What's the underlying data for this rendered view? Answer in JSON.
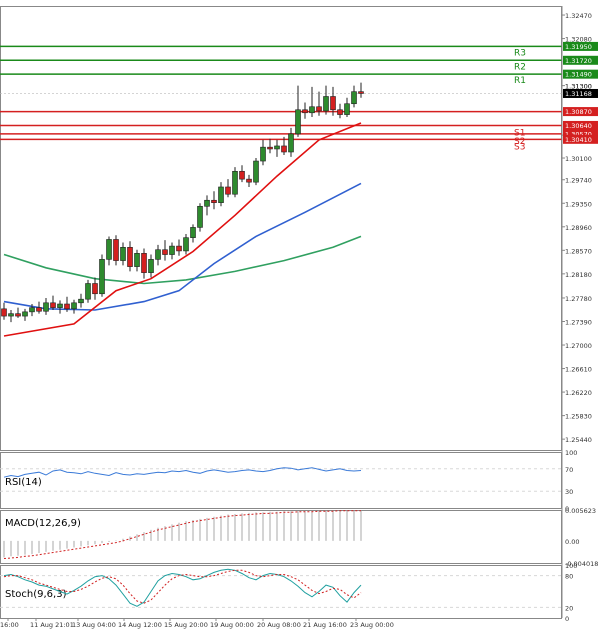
{
  "colors": {
    "bull": "#2e8b2e",
    "bear": "#d42020",
    "resistance": "#1a8a1a",
    "support": "#d42020",
    "ma_fast": "#e01010",
    "ma_mid": "#3060d0",
    "ma_slow": "#30a060",
    "rsi": "#3a7ad8",
    "macd_hist": "#aaaaaa",
    "macd_signal": "#d02020",
    "stoch_main": "#20a0a0",
    "stoch_signal": "#d02020",
    "grid": "#d8d8d8"
  },
  "chart_data": [
    {
      "type": "candlestick",
      "panel": "main",
      "ylim": [
        1.2526,
        1.3262
      ],
      "y_ticks": [
        "1.32470",
        "1.32080",
        "1.31300",
        "1.30480",
        "1.30100",
        "1.29740",
        "1.29350",
        "1.28960",
        "1.28570",
        "1.28180",
        "1.27780",
        "1.27390",
        "1.27000",
        "1.26610",
        "1.26220",
        "1.25830",
        "1.25440"
      ],
      "x_ticks": [
        "16:00",
        "11 Aug 21:01",
        "13 Aug 04:00",
        "14 Aug 12:00",
        "15 Aug 20:00",
        "19 Aug 00:00",
        "20 Aug 08:00",
        "21 Aug 16:00",
        "23 Aug 00:00"
      ],
      "candles": [
        [
          1.276,
          1.277,
          1.2742,
          1.2748
        ],
        [
          1.2748,
          1.2758,
          1.2738,
          1.2752
        ],
        [
          1.2752,
          1.2762,
          1.2745,
          1.2748
        ],
        [
          1.2748,
          1.276,
          1.274,
          1.2755
        ],
        [
          1.2755,
          1.2768,
          1.2748,
          1.2762
        ],
        [
          1.2762,
          1.2772,
          1.2752,
          1.2756
        ],
        [
          1.2756,
          1.2778,
          1.275,
          1.277
        ],
        [
          1.277,
          1.2782,
          1.2758,
          1.2762
        ],
        [
          1.2762,
          1.2774,
          1.2752,
          1.2768
        ],
        [
          1.2768,
          1.278,
          1.2755,
          1.276
        ],
        [
          1.276,
          1.2775,
          1.2752,
          1.277
        ],
        [
          1.277,
          1.2785,
          1.2762,
          1.2776
        ],
        [
          1.2776,
          1.2808,
          1.277,
          1.2802
        ],
        [
          1.2802,
          1.2812,
          1.2775,
          1.2785
        ],
        [
          1.2785,
          1.285,
          1.278,
          1.2842
        ],
        [
          1.2842,
          1.288,
          1.2832,
          1.2875
        ],
        [
          1.2875,
          1.2882,
          1.2832,
          1.284
        ],
        [
          1.284,
          1.287,
          1.2832,
          1.2862
        ],
        [
          1.2862,
          1.2872,
          1.2822,
          1.283
        ],
        [
          1.283,
          1.2858,
          1.2822,
          1.2852
        ],
        [
          1.2852,
          1.286,
          1.281,
          1.282
        ],
        [
          1.282,
          1.285,
          1.2812,
          1.2842
        ],
        [
          1.2842,
          1.2866,
          1.2832,
          1.2858
        ],
        [
          1.2858,
          1.2874,
          1.284,
          1.285
        ],
        [
          1.285,
          1.287,
          1.2842,
          1.2864
        ],
        [
          1.2864,
          1.2875,
          1.2848,
          1.2856
        ],
        [
          1.2856,
          1.2884,
          1.285,
          1.2878
        ],
        [
          1.2878,
          1.29,
          1.287,
          1.2895
        ],
        [
          1.2895,
          1.2935,
          1.2888,
          1.293
        ],
        [
          1.293,
          1.2948,
          1.2915,
          1.294
        ],
        [
          1.294,
          1.2955,
          1.2925,
          1.2936
        ],
        [
          1.2936,
          1.297,
          1.293,
          1.2962
        ],
        [
          1.2962,
          1.2975,
          1.2945,
          1.295
        ],
        [
          1.295,
          1.2995,
          1.2945,
          1.2988
        ],
        [
          1.2988,
          1.2998,
          1.297,
          1.2975
        ],
        [
          1.2975,
          1.2982,
          1.2962,
          1.297
        ],
        [
          1.297,
          1.301,
          1.2965,
          1.3005
        ],
        [
          1.3005,
          1.304,
          1.2998,
          1.3028
        ],
        [
          1.3028,
          1.3042,
          1.3018,
          1.3025
        ],
        [
          1.3025,
          1.304,
          1.3012,
          1.303
        ],
        [
          1.303,
          1.3045,
          1.3015,
          1.302
        ],
        [
          1.302,
          1.306,
          1.3012,
          1.305
        ],
        [
          1.305,
          1.313,
          1.3045,
          1.309
        ],
        [
          1.309,
          1.3102,
          1.3075,
          1.3085
        ],
        [
          1.3085,
          1.3128,
          1.3078,
          1.3095
        ],
        [
          1.3095,
          1.312,
          1.308,
          1.3088
        ],
        [
          1.3088,
          1.313,
          1.3082,
          1.3112
        ],
        [
          1.3112,
          1.3128,
          1.308,
          1.309
        ],
        [
          1.309,
          1.31,
          1.3076,
          1.3082
        ],
        [
          1.3082,
          1.311,
          1.3078,
          1.31
        ],
        [
          1.31,
          1.313,
          1.3094,
          1.312
        ],
        [
          1.312,
          1.3135,
          1.311,
          1.3117
        ]
      ],
      "ma_fast_path": [
        [
          0,
          1.2715
        ],
        [
          10,
          1.2735
        ],
        [
          16,
          1.279
        ],
        [
          21,
          1.281
        ],
        [
          27,
          1.2855
        ],
        [
          33,
          1.2915
        ],
        [
          39,
          1.298
        ],
        [
          45,
          1.304
        ],
        [
          51,
          1.3068
        ]
      ],
      "ma_mid_path": [
        [
          0,
          1.2772
        ],
        [
          6,
          1.276
        ],
        [
          13,
          1.2758
        ],
        [
          20,
          1.2772
        ],
        [
          25,
          1.279
        ],
        [
          30,
          1.2835
        ],
        [
          36,
          1.288
        ],
        [
          43,
          1.292
        ],
        [
          51,
          1.2968
        ]
      ],
      "ma_slow_path": [
        [
          0,
          1.285
        ],
        [
          6,
          1.2828
        ],
        [
          13,
          1.281
        ],
        [
          20,
          1.2802
        ],
        [
          26,
          1.2808
        ],
        [
          33,
          1.2822
        ],
        [
          40,
          1.284
        ],
        [
          47,
          1.2862
        ],
        [
          51,
          1.288
        ]
      ],
      "levels": [
        {
          "label": "R3",
          "value_text": "1.31950",
          "value": 1.3195,
          "kind": "resistance"
        },
        {
          "label": "R2",
          "value_text": "1.31720",
          "value": 1.3172,
          "kind": "resistance"
        },
        {
          "label": "R1",
          "value_text": "1.31490",
          "value": 1.3149,
          "kind": "resistance"
        },
        {
          "label": "",
          "value_text": "1.30870",
          "value": 1.3087,
          "kind": "support"
        },
        {
          "label": "S1",
          "value_text": "1.30640",
          "value": 1.3064,
          "kind": "support"
        },
        {
          "label": "S2",
          "value_text": "1.30570",
          "value": 1.305,
          "kind": "support"
        },
        {
          "label": "S3",
          "value_text": "1.30410",
          "value": 1.3041,
          "kind": "support"
        }
      ],
      "current_price_text": "1.31168",
      "current_price": 1.3117,
      "extra_tick_text": "1.31300"
    },
    {
      "type": "line",
      "panel": "rsi",
      "title": "RSI(14)",
      "ylim": [
        0,
        100
      ],
      "y_ticks": [
        "100",
        "70",
        "30",
        "0"
      ],
      "values": [
        55,
        58,
        56,
        60,
        62,
        64,
        59,
        66,
        68,
        64,
        63,
        61,
        65,
        62,
        60,
        58,
        63,
        60,
        59,
        61,
        60,
        62,
        64,
        63,
        66,
        65,
        67,
        64,
        62,
        66,
        68,
        66,
        64,
        65,
        67,
        68,
        66,
        65,
        67,
        70,
        72,
        71,
        68,
        70,
        72,
        69,
        66,
        68,
        70,
        67,
        66,
        67
      ]
    },
    {
      "type": "bar+line",
      "panel": "macd",
      "title": "MACD(12,26,9)",
      "ylim": [
        -0.004018,
        0.005623
      ],
      "y_ticks": [
        "0.005623",
        "0.00",
        "-0.004018"
      ],
      "hist": [
        -0.003,
        -0.0028,
        -0.0027,
        -0.0025,
        -0.0024,
        -0.0022,
        -0.002,
        -0.0018,
        -0.0016,
        -0.0014,
        -0.0012,
        -0.001,
        -0.0008,
        -0.0006,
        -0.0004,
        -0.0002,
        0.0001,
        0.0004,
        0.0008,
        0.0012,
        0.0016,
        0.002,
        0.0024,
        0.0027,
        0.003,
        0.0033,
        0.0036,
        0.0038,
        0.004,
        0.0042,
        0.0044,
        0.0046,
        0.0048,
        0.0049,
        0.005,
        0.0051,
        0.0052,
        0.0052,
        0.0053,
        0.0053,
        0.0054,
        0.0054,
        0.0054,
        0.0054,
        0.0054,
        0.0055,
        0.0055,
        0.0055,
        0.0055,
        0.0055,
        0.0055,
        0.0055
      ],
      "signal": [
        -0.0032,
        -0.0031,
        -0.003,
        -0.0028,
        -0.0027,
        -0.0025,
        -0.0023,
        -0.0021,
        -0.0019,
        -0.0017,
        -0.0015,
        -0.0013,
        -0.0011,
        -0.0009,
        -0.0007,
        -0.0005,
        -0.0003,
        0.0,
        0.0004,
        0.0008,
        0.0012,
        0.0016,
        0.002,
        0.0023,
        0.0026,
        0.0029,
        0.0032,
        0.0035,
        0.0037,
        0.0039,
        0.0041,
        0.0043,
        0.0045,
        0.0046,
        0.0047,
        0.0048,
        0.0049,
        0.005,
        0.005,
        0.0051,
        0.0052,
        0.0052,
        0.0053,
        0.0053,
        0.0053,
        0.0054,
        0.0054,
        0.0054,
        0.0055,
        0.0055,
        0.0055,
        0.0055
      ]
    },
    {
      "type": "line",
      "panel": "stoch",
      "title": "Stoch(9,6,3)",
      "ylim": [
        0,
        100
      ],
      "y_ticks": [
        "100",
        "80",
        "20",
        "0"
      ],
      "main": [
        80,
        82,
        78,
        72,
        68,
        62,
        60,
        55,
        50,
        45,
        52,
        60,
        70,
        78,
        80,
        74,
        62,
        45,
        28,
        22,
        30,
        50,
        70,
        80,
        84,
        82,
        78,
        72,
        74,
        80,
        86,
        90,
        92,
        90,
        84,
        76,
        72,
        80,
        84,
        82,
        78,
        70,
        60,
        48,
        40,
        50,
        62,
        58,
        42,
        30,
        48,
        62
      ],
      "signal": [
        78,
        80,
        80,
        76,
        72,
        66,
        62,
        58,
        54,
        50,
        50,
        54,
        60,
        68,
        75,
        78,
        74,
        62,
        46,
        32,
        28,
        34,
        48,
        62,
        74,
        80,
        82,
        80,
        78,
        78,
        80,
        84,
        88,
        90,
        90,
        86,
        80,
        78,
        80,
        82,
        82,
        78,
        72,
        62,
        52,
        46,
        50,
        56,
        54,
        44,
        38,
        48
      ]
    }
  ]
}
